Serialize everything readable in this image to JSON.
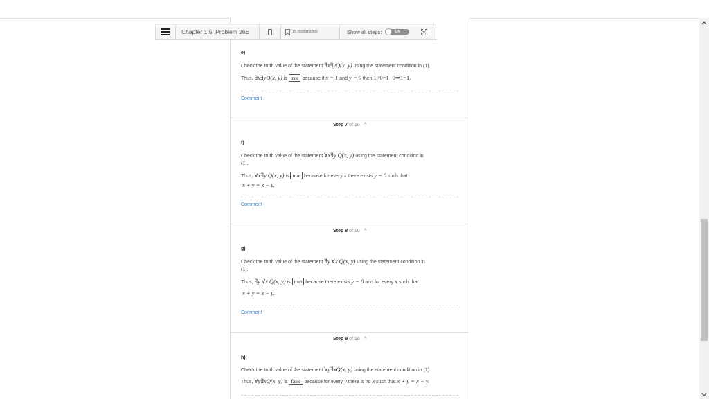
{
  "toolbar": {
    "title": "Chapter 1.5, Problem 26E",
    "bookmarks_label": "(5 Bookmarks)",
    "show_all_steps_label": "Show all steps:",
    "toggle_label": "ON"
  },
  "section_e": {
    "label": "e)",
    "line1_pre": "Check the truth value of the statement",
    "line1_math": "∃x∃yQ(x, y)",
    "line1_post": "using the statement condition in (1).",
    "line2_pre": "Thus,",
    "line2_math": "∃x∃yQ(x, y)",
    "line2_is": "is",
    "line2_box": "true",
    "line2_because": "because if",
    "line2_cond1": "x = 1",
    "line2_and": "and",
    "line2_cond2": "y = 0",
    "line2_then": "then",
    "line2_eq": "1+0=1−0⇒1=1.",
    "comment": "Comment"
  },
  "step7": {
    "header_step": "Step 7",
    "header_of": "of 10",
    "label": "f)",
    "line1_pre": "Check the truth value of the statement",
    "line1_math": "∀x∃y Q(x, y)",
    "line1_post": "using the statement condition in",
    "line1_cont": "(1).",
    "line2_pre": "Thus,",
    "line2_math": "∀x∃y Q(x, y)",
    "line2_is": "is",
    "line2_box": "true",
    "line2_rest": "because for every",
    "line2_x": "x",
    "line2_there": "there exists",
    "line2_cond": "y = 0",
    "line2_such": "such that",
    "line3_math": "x + y = x − y.",
    "comment": "Comment"
  },
  "step8": {
    "header_step": "Step 8",
    "header_of": "of 10",
    "label": "g)",
    "line1_pre": "Check the truth value of the statement",
    "line1_math": "∃y ∀x Q(x, y)",
    "line1_post": "using the statement condition in",
    "line1_cont": "(1).",
    "line2_pre": "Thus,",
    "line2_math": "∃y ∀x Q(x, y)",
    "line2_is": "is",
    "line2_box": "true",
    "line2_rest": "because there exists",
    "line2_cond": "y = 0",
    "line2_and": "and for every",
    "line2_x": "x",
    "line2_such": "such that",
    "line3_math": "x + y = x − y.",
    "comment": "Comment"
  },
  "step9": {
    "header_step": "Step 9",
    "header_of": "of 10",
    "label": "h)",
    "line1_pre": "Check the truth value of the statement",
    "line1_math": "∀y∃xQ(x, y)",
    "line1_post": "using the statement condition in (1).",
    "line2_pre": "Thus,",
    "line2_math": "∀y∃xQ(x, y)",
    "line2_is": "is",
    "line2_box": "false",
    "line2_rest": "because for every",
    "line2_y": "y",
    "line2_there": "there is no",
    "line2_x": "x",
    "line2_such": "such that",
    "line2_eq": "x + y = x − y."
  },
  "icons": {
    "menu": "list-icon",
    "phone": "phone-icon",
    "bookmark": "bookmark-icon",
    "expand": "expand-icon",
    "scroll_up": "chevron-up-icon",
    "scroll_down": "chevron-down-icon",
    "step_collapse": "chevron-up-icon"
  },
  "colors": {
    "link": "#3c80c8",
    "toolbar_bg": "#f5f5f5",
    "toggle_bg": "#8f8f8f"
  }
}
